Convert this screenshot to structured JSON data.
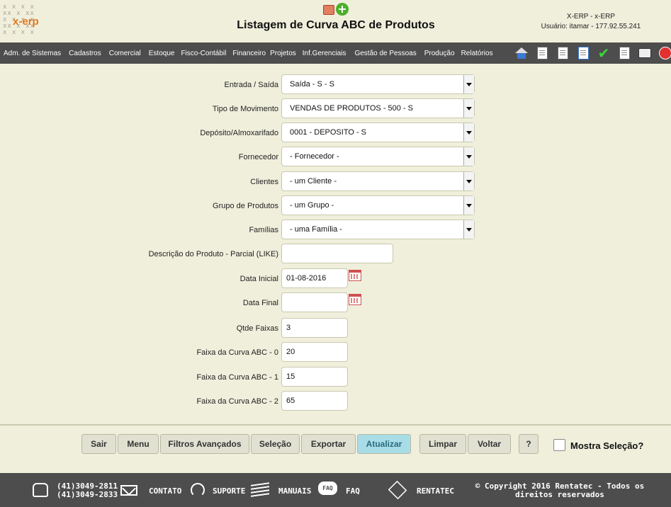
{
  "header": {
    "logo_text": "x-erp",
    "title": "Listagem de Curva ABC de Produtos",
    "user_line1": "X-ERP - x-ERP",
    "user_line2": "Usuário: itamar - 177.92.55.241"
  },
  "menu": [
    "Adm. de Sistemas",
    "Cadastros",
    "Comercial",
    "Estoque",
    "Fisco-Contábil",
    "Financeiro",
    "Projetos",
    "Inf.Gerenciais",
    "Gestão de Pessoas",
    "Produção",
    "Relatórios"
  ],
  "toolbar_icons": [
    "home-icon",
    "edit-icon",
    "document-icon",
    "import-icon",
    "check-icon",
    "new-document-icon",
    "printer-icon",
    "power-icon"
  ],
  "form": {
    "entrada_saida": {
      "label": "Entrada / Saída",
      "value": "Saída - S - S"
    },
    "tipo_movimento": {
      "label": "Tipo de Movimento",
      "value": "VENDAS DE PRODUTOS - 500 - S"
    },
    "deposito": {
      "label": "Depósito/Almoxarifado",
      "value": "0001 - DEPOSITO - S"
    },
    "fornecedor": {
      "label": "Fornecedor",
      "value": "- Fornecedor -"
    },
    "clientes": {
      "label": "Clientes",
      "value": "- um Cliente -"
    },
    "grupo_produtos": {
      "label": "Grupo de Produtos",
      "value": "- um Grupo -"
    },
    "familias": {
      "label": "Famílias",
      "value": "- uma Família -"
    },
    "descricao": {
      "label": "Descrição do Produto - Parcial (LIKE)",
      "value": ""
    },
    "data_inicial": {
      "label": "Data Inicial",
      "value": "01-08-2016"
    },
    "data_final": {
      "label": "Data Final",
      "value": ""
    },
    "qtde_faixas": {
      "label": "Qtde Faixas",
      "value": "3"
    },
    "faixa_0": {
      "label": "Faixa da Curva ABC - 0",
      "value": "20"
    },
    "faixa_1": {
      "label": "Faixa da Curva ABC - 1",
      "value": "15"
    },
    "faixa_2": {
      "label": "Faixa da Curva ABC - 2",
      "value": "65"
    }
  },
  "buttons": {
    "sair": "Sair",
    "menu": "Menu",
    "filtros": "Filtros Avançados",
    "selecao": "Seleção",
    "exportar": "Exportar",
    "atualizar": "Atualizar",
    "limpar": "Limpar",
    "voltar": "Voltar",
    "help": "?"
  },
  "mostra_selecao": {
    "label": "Mostra Seleção?",
    "checked": false
  },
  "footer": {
    "phone1": "(41)3049-2811",
    "phone2": "(41)3049-2833",
    "contato": "CONTATO",
    "suporte": "SUPORTE",
    "manuais": "MANUAIS",
    "faq": "FAQ",
    "rentatec": "RENTATEC",
    "copyright1": "© Copyright 2016 Rentatec - Todos os",
    "copyright2": "direitos reservados"
  }
}
